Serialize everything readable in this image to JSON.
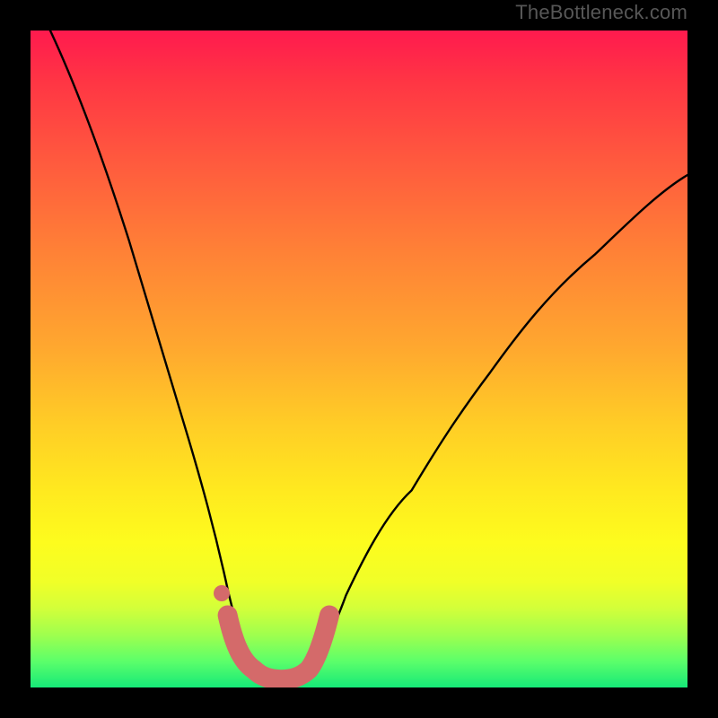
{
  "watermark": {
    "text": "TheBottleneck.com"
  },
  "chart_data": {
    "type": "line",
    "title": "",
    "xlabel": "",
    "ylabel": "",
    "xlim": [
      0,
      100
    ],
    "ylim": [
      0,
      100
    ],
    "grid": false,
    "legend": "none",
    "series": [
      {
        "name": "bottleneck-curve",
        "note": "V-shaped curve; y ≈ 0 is green (no bottleneck), y ≈ 100 is red (severe bottleneck). Minimum around x ≈ 33–40.",
        "x": [
          3,
          6,
          9,
          12,
          15,
          18,
          21,
          24,
          27,
          29,
          31,
          33,
          35,
          37,
          39,
          41,
          43,
          46,
          50,
          55,
          60,
          66,
          73,
          80,
          88,
          96,
          100
        ],
        "y": [
          100,
          89,
          78,
          67,
          57,
          47,
          38,
          29,
          21,
          15,
          9,
          5,
          2,
          1,
          1,
          2,
          4,
          8,
          14,
          22,
          30,
          39,
          48,
          57,
          66,
          74,
          78
        ]
      }
    ],
    "annotations": [
      {
        "name": "min-highlight",
        "note": "Salmon/pink U-shaped marker highlighting the trough",
        "x": [
          30,
          31.5,
          33,
          35,
          37,
          39,
          41,
          42.5,
          44
        ],
        "y": [
          11,
          6,
          3,
          1.5,
          1.2,
          1.5,
          3,
          6,
          11
        ]
      }
    ]
  },
  "colors": {
    "curve": "#000000",
    "highlight": "#d46a6a",
    "frame": "#000000"
  }
}
